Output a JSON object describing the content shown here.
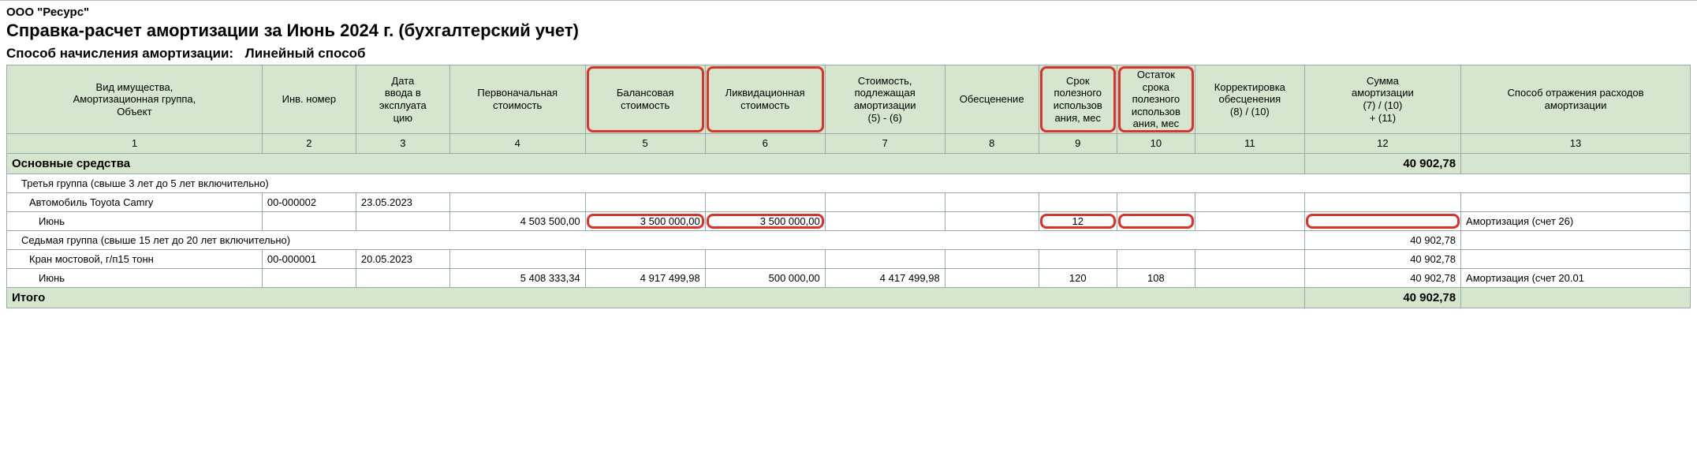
{
  "company": "ООО \"Ресурс\"",
  "title": "Справка-расчет амортизации за Июнь 2024 г. (бухгалтерский учет)",
  "method_label": "Способ начисления амортизации:",
  "method_value": "Линейный способ",
  "headers": {
    "c1": "Вид имущества,\nАмортизационная группа,\nОбъект",
    "c2": "Инв. номер",
    "c3": "Дата\nввода в\nэксплуата\nцию",
    "c4": "Первоначальная\nстоимость",
    "c5": "Балансовая\nстоимость",
    "c6": "Ликвидационная\nстоимость",
    "c7": "Стоимость,\nподлежащая\nамортизации\n(5) - (6)",
    "c8": "Обесценение",
    "c9": "Срок\nполезного\nиспользов\nания, мес",
    "c10": "Остаток\nсрока\nполезного\nиспользов\nания, мес",
    "c11": "Корректировка\nобесценения\n(8) / (10)",
    "c12": "Сумма\nамортизации\n(7) / (10)\n+ (11)",
    "c13": "Способ отражения расходов\nамортизации"
  },
  "colnums": {
    "c1": "1",
    "c2": "2",
    "c3": "3",
    "c4": "4",
    "c5": "5",
    "c6": "6",
    "c7": "7",
    "c8": "8",
    "c9": "9",
    "c10": "10",
    "c11": "11",
    "c12": "12",
    "c13": "13"
  },
  "section_fixed_assets": "Основные средства",
  "section_fixed_assets_sum": "40 902,78",
  "group3": "Третья группа (свыше 3 лет до 5 лет включительно)",
  "item_camry": {
    "name": "Автомобиль Toyota Camry",
    "inv": "00-000002",
    "date": "23.05.2023"
  },
  "month_camry": {
    "label": "Июнь",
    "cost_initial": "4 503 500,00",
    "cost_balance": "3 500 000,00",
    "cost_liquidation": "3 500 000,00",
    "cost_amort": "",
    "impairment": "",
    "term": "12",
    "term_remain": "",
    "corr": "",
    "sum": "",
    "expense": "Амортизация (счет 26)"
  },
  "group7": "Седьмая группа (свыше 15 лет до 20 лет включительно)",
  "group7_sum": "40 902,78",
  "item_crane": {
    "name": "Кран мостовой, г/п15 тонн",
    "inv": "00-000001",
    "date": "20.05.2023",
    "sum": "40 902,78"
  },
  "month_crane": {
    "label": "Июнь",
    "cost_initial": "5 408 333,34",
    "cost_balance": "4 917 499,98",
    "cost_liquidation": "500 000,00",
    "cost_amort": "4 417 499,98",
    "impairment": "",
    "term": "120",
    "term_remain": "108",
    "corr": "",
    "sum": "40 902,78",
    "expense": "Амортизация (счет 20.01"
  },
  "total_label": "Итого",
  "total_sum": "40 902,78"
}
